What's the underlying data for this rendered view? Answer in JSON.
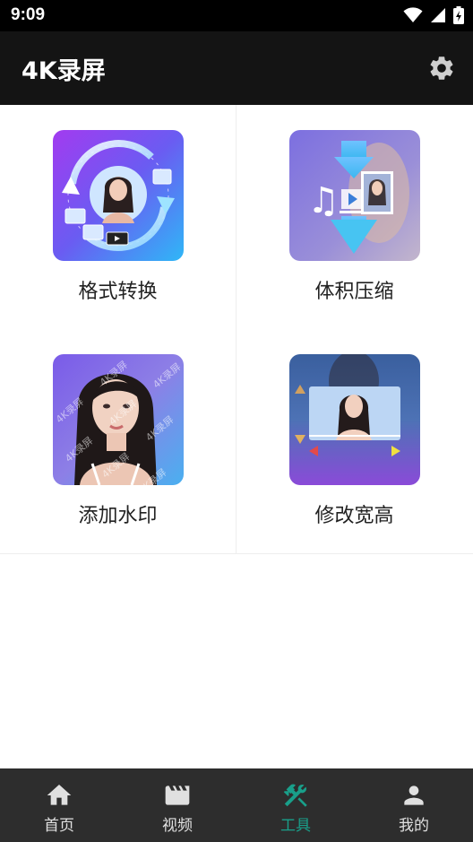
{
  "status_bar": {
    "time": "9:09"
  },
  "app_bar": {
    "title": "4K录屏"
  },
  "tools": [
    {
      "label": "格式转换"
    },
    {
      "label": "体积压缩"
    },
    {
      "label": "添加水印",
      "watermark_text": "4K录屏"
    },
    {
      "label": "修改宽高"
    }
  ],
  "bottom_nav": {
    "items": [
      {
        "label": "首页",
        "icon": "home-icon"
      },
      {
        "label": "视频",
        "icon": "movie-icon"
      },
      {
        "label": "工具",
        "icon": "tools-icon",
        "active": true
      },
      {
        "label": "我的",
        "icon": "person-icon"
      }
    ]
  },
  "colors": {
    "accent": "#199f8a",
    "app_bar": "#141414",
    "bottom_nav": "#2d2d2d"
  }
}
